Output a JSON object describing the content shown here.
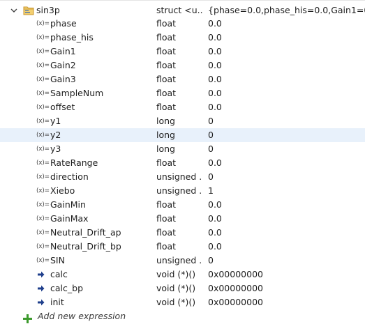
{
  "root": {
    "name": "sin3p",
    "type": "struct <u...",
    "value": "{phase=0.0,phase_his=0.0,Gain1=0.0,Ga"
  },
  "children": [
    {
      "name": "phase",
      "type": "float",
      "value": "0.0",
      "icon": "variable-icon"
    },
    {
      "name": "phase_his",
      "type": "float",
      "value": "0.0",
      "icon": "variable-icon"
    },
    {
      "name": "Gain1",
      "type": "float",
      "value": "0.0",
      "icon": "variable-icon"
    },
    {
      "name": "Gain2",
      "type": "float",
      "value": "0.0",
      "icon": "variable-icon"
    },
    {
      "name": "Gain3",
      "type": "float",
      "value": "0.0",
      "icon": "variable-icon"
    },
    {
      "name": "SampleNum",
      "type": "float",
      "value": "0.0",
      "icon": "variable-icon"
    },
    {
      "name": "offset",
      "type": "float",
      "value": "0.0",
      "icon": "variable-icon"
    },
    {
      "name": "y1",
      "type": "long",
      "value": "0",
      "icon": "variable-icon"
    },
    {
      "name": "y2",
      "type": "long",
      "value": "0",
      "icon": "variable-icon",
      "selected": true
    },
    {
      "name": "y3",
      "type": "long",
      "value": "0",
      "icon": "variable-icon"
    },
    {
      "name": "RateRange",
      "type": "float",
      "value": "0.0",
      "icon": "variable-icon"
    },
    {
      "name": "direction",
      "type": "unsigned ...",
      "value": "0",
      "icon": "variable-icon"
    },
    {
      "name": "Xiebo",
      "type": "unsigned ...",
      "value": "1",
      "icon": "variable-icon"
    },
    {
      "name": "GainMin",
      "type": "float",
      "value": "0.0",
      "icon": "variable-icon"
    },
    {
      "name": "GainMax",
      "type": "float",
      "value": "0.0",
      "icon": "variable-icon"
    },
    {
      "name": "Neutral_Drift_ap",
      "type": "float",
      "value": "0.0",
      "icon": "variable-icon"
    },
    {
      "name": "Neutral_Drift_bp",
      "type": "float",
      "value": "0.0",
      "icon": "variable-icon"
    },
    {
      "name": "SIN",
      "type": "unsigned ...",
      "value": "0",
      "icon": "variable-icon"
    },
    {
      "name": "calc",
      "type": "void (*)()",
      "value": "0x00000000",
      "icon": "function-pointer-icon"
    },
    {
      "name": "calc_bp",
      "type": "void (*)()",
      "value": "0x00000000",
      "icon": "function-pointer-icon"
    },
    {
      "name": "init",
      "type": "void (*)()",
      "value": "0x00000000",
      "icon": "function-pointer-icon"
    }
  ],
  "var_icon_glyph": "(x)=",
  "add_new_expression": "Add new expression",
  "colors": {
    "selected_row": "#e8f1fb",
    "arrow": "#1f3f8c",
    "folder": "#e6b64a",
    "add_plus": "#3c9a2c"
  }
}
